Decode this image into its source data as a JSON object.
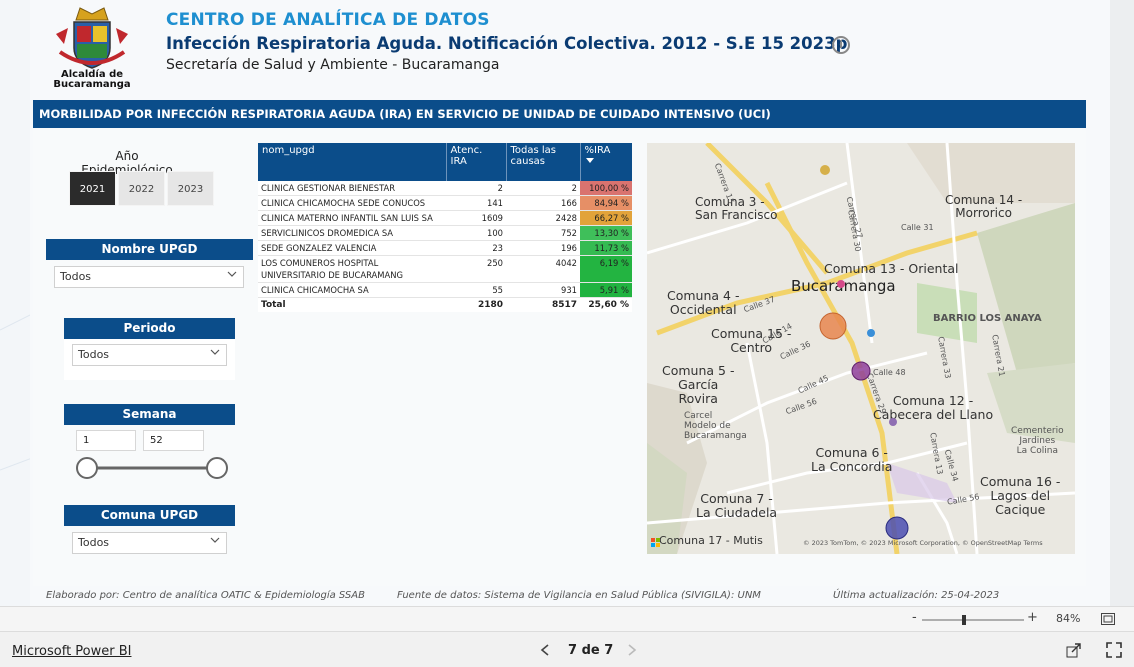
{
  "header": {
    "logo_caption_line1": "Alcaldía de",
    "logo_caption_line2": "Bucaramanga",
    "title": "CENTRO DE ANALÍTICA DE DATOS",
    "subtitle": "Infección Respiratoria Aguda. Notificación Colectiva. 2012 - S.E 15 2023p",
    "department": "Secretaría de Salud y Ambiente - Bucaramanga"
  },
  "section_title": "MORBILIDAD POR INFECCIÓN RESPIRATORIA AGUDA (IRA) EN SERVICIO DE UNIDAD DE CUIDADO INTENSIVO (UCI)",
  "filters": {
    "year": {
      "label": "Año Epidemiológico",
      "options": [
        "2021",
        "2022",
        "2023"
      ],
      "selected": "2021"
    },
    "upgd": {
      "label": "Nombre UPGD",
      "value": "Todos"
    },
    "period": {
      "label": "Periodo",
      "value": "Todos"
    },
    "week": {
      "label": "Semana",
      "min": "1",
      "max": "52"
    },
    "commune": {
      "label": "Comuna UPGD",
      "value": "Todos"
    }
  },
  "table": {
    "columns": [
      "nom_upgd",
      "Atenc. IRA",
      "Todas las causas",
      "%IRA"
    ],
    "rows": [
      {
        "name": "CLINICA GESTIONAR BIENESTAR",
        "ira": "2",
        "all": "2",
        "pct": "100,00 %",
        "color": "#d9736f"
      },
      {
        "name": "CLINICA CHICAMOCHA SEDE CONUCOS",
        "ira": "141",
        "all": "166",
        "pct": "84,94 %",
        "color": "#e68f66"
      },
      {
        "name": "CLINICA MATERNO INFANTIL SAN LUIS SA",
        "ira": "1609",
        "all": "2428",
        "pct": "66,27 %",
        "color": "#e2a33a"
      },
      {
        "name": "SERVICLINICOS DROMEDICA SA",
        "ira": "100",
        "all": "752",
        "pct": "13,30 %",
        "color": "#3fbf5a"
      },
      {
        "name": "SEDE GONZALEZ VALENCIA",
        "ira": "23",
        "all": "196",
        "pct": "11,73 %",
        "color": "#35bb52"
      },
      {
        "name": "LOS COMUNEROS HOSPITAL UNIVERSITARIO DE BUCARAMANG",
        "ira": "250",
        "all": "4042",
        "pct": "6,19 %",
        "color": "#23b441"
      },
      {
        "name": "CLINICA CHICAMOCHA SA",
        "ira": "55",
        "all": "931",
        "pct": "5,91 %",
        "color": "#21b340"
      }
    ],
    "total": {
      "label": "Total",
      "ira": "2180",
      "all": "8517",
      "pct": "25,60 %"
    }
  },
  "map": {
    "labels": {
      "c3": "Comuna 3 -",
      "c3b": "San Francisco",
      "c14": "Comuna 14 -",
      "c14b": "Morrorico",
      "c13": "Comuna 13 - Oriental",
      "city": "Bucaramanga",
      "c4": "Comuna 4 -",
      "c4b": "Occidental",
      "c15": "Comuna 15 -",
      "c15b": "Centro",
      "losanaya": "BARRIO LOS ANAYA",
      "c5": "Comuna 5 -",
      "c5b": "García",
      "c5c": "Rovira",
      "c12": "Comuna 12 -",
      "c12b": "Cabecera del Llano",
      "cem": "Cementerio",
      "cemb": "Jardines",
      "cemc": "La Colina",
      "carcel": "Carcel",
      "carcelb": "Modelo de",
      "carcelc": "Bucaramanga",
      "c6": "Comuna 6 -",
      "c6b": "La Concordia",
      "c7": "Comuna 7 -",
      "c7b": "La Ciudadela",
      "c16": "Comuna 16 -",
      "c16b": "Lagos del",
      "c16c": "Cacique",
      "c17": "Comuna 17 - Mutis",
      "streets": [
        "Carrera 15",
        "Carrera 27",
        "Carrera 30",
        "Calle 31",
        "Calle 37",
        "Calle 36",
        "Carrera 33",
        "Calle 45",
        "Calle 48",
        "Carrera 29",
        "Carrera 21",
        "Carrera 13",
        "Calle 56",
        "Calle 34",
        "Calle 14",
        "Calle 56"
      ],
      "attribution": "© 2023 TomTom, © 2023 Microsoft Corporation, © OpenStreetMap  Terms"
    },
    "bubbles": [
      {
        "color": "#e8864f",
        "size": "large"
      },
      {
        "color": "#8f3f9a",
        "size": "medium"
      },
      {
        "color": "#4b4db0",
        "size": "medium"
      },
      {
        "color": "#d6b04a",
        "size": "small"
      },
      {
        "color": "#d44a8a",
        "size": "small"
      },
      {
        "color": "#3a8fd8",
        "size": "small"
      },
      {
        "color": "#8f6fb3",
        "size": "small"
      }
    ]
  },
  "footer": {
    "credits": "Elaborado por: Centro de analítica OATIC & Epidemiología SSAB",
    "source": "Fuente de datos: Sistema de Vigilancia en Salud Pública (SIVIGILA): UNM",
    "updated": "Última actualización:  25-04-2023"
  },
  "zoom": {
    "minus": "-",
    "plus": "+",
    "level": "84%"
  },
  "bottom": {
    "brand": "Microsoft Power BI",
    "page": "7 de 7"
  }
}
